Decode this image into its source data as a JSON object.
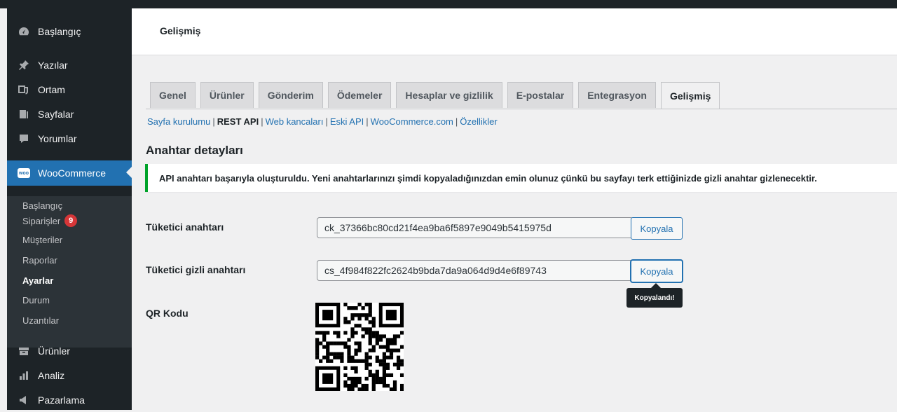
{
  "sidebar": {
    "items": [
      {
        "label": "Başlangıç",
        "icon": "dashboard-icon"
      },
      {
        "label": "Yazılar",
        "icon": "pin-icon"
      },
      {
        "label": "Ortam",
        "icon": "media-icon"
      },
      {
        "label": "Sayfalar",
        "icon": "pages-icon"
      },
      {
        "label": "Yorumlar",
        "icon": "comments-icon"
      },
      {
        "label": "WooCommerce",
        "icon": "woocommerce-icon",
        "logo_text": "woo"
      },
      {
        "label": "Ürünler",
        "icon": "products-icon"
      },
      {
        "label": "Analiz",
        "icon": "analytics-icon"
      },
      {
        "label": "Pazarlama",
        "icon": "marketing-icon"
      }
    ],
    "submenu": [
      {
        "label": "Başlangıç"
      },
      {
        "label": "Siparişler",
        "badge": "9"
      },
      {
        "label": "Müşteriler"
      },
      {
        "label": "Raporlar"
      },
      {
        "label": "Ayarlar"
      },
      {
        "label": "Durum"
      },
      {
        "label": "Uzantılar"
      }
    ]
  },
  "header": {
    "title": "Gelişmiş"
  },
  "tabs": [
    "Genel",
    "Ürünler",
    "Gönderim",
    "Ödemeler",
    "Hesaplar ve gizlilik",
    "E-postalar",
    "Entegrasyon",
    "Gelişmiş"
  ],
  "subsub": [
    {
      "label": "Sayfa kurulumu"
    },
    {
      "label": "REST API"
    },
    {
      "label": "Web kancaları"
    },
    {
      "label": "Eski API"
    },
    {
      "label": "WooCommerce.com"
    },
    {
      "label": "Özellikler"
    }
  ],
  "page": {
    "heading": "Anahtar detayları",
    "notice": "API anahtarı başarıyla oluşturuldu. Yeni anahtarlarınızı şimdi kopyaladığınızdan emin olunuz çünkü bu sayfayı terk ettiğinizde gizli anahtar gizlenecektir.",
    "consumer_key_label": "Tüketici anahtarı",
    "consumer_key": "ck_37366bc80cd21f4ea9ba6f5897e9049b5415975d",
    "consumer_secret_label": "Tüketici gizli anahtarı",
    "consumer_secret": "cs_4f984f822fc2624b9bda7da9a064d9d4e6f89743",
    "copy_label": "Kopyala",
    "tooltip": "Kopyalandı!",
    "qr_label": "QR Kodu"
  },
  "colors": {
    "accent": "#2271b1",
    "sidebar": "#1d2327",
    "success": "#00a32a",
    "badge": "#d63638"
  }
}
